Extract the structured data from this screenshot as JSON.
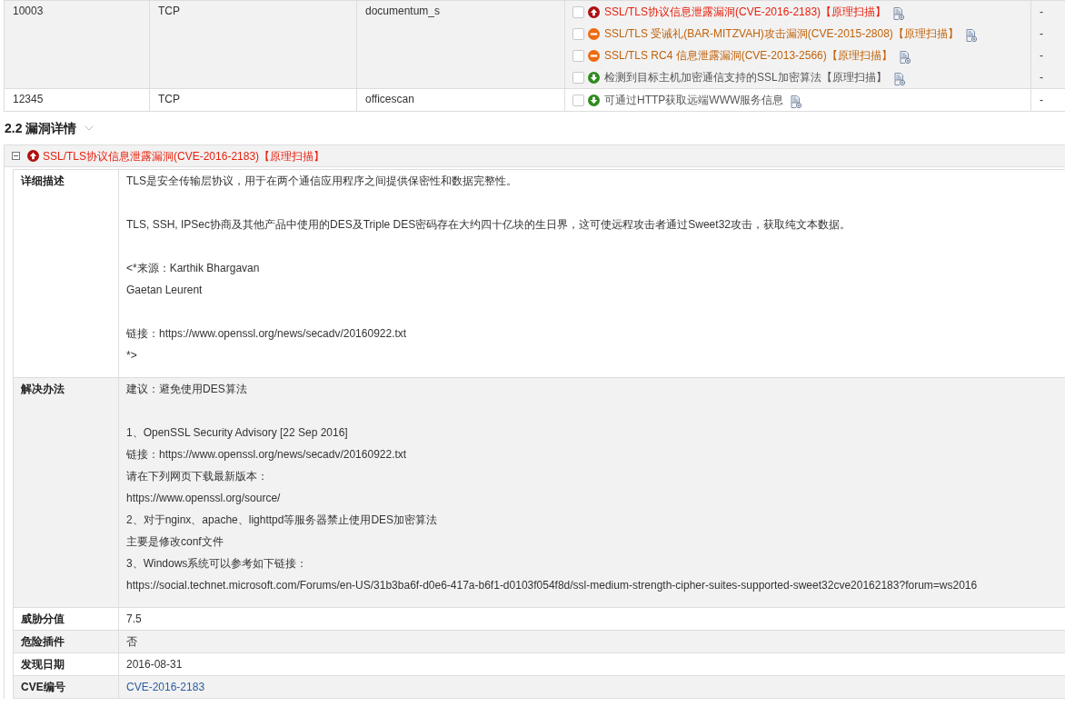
{
  "ports_table": {
    "rows": [
      {
        "port": "10003",
        "protocol": "TCP",
        "service": "documentum_s",
        "vulns": [
          {
            "kind": "high",
            "name": "SSL/TLS协议信息泄露漏洞(CVE-2016-2183)",
            "tag": "【原理扫描】",
            "checked": false,
            "extra": "-"
          },
          {
            "kind": "medium",
            "name": "SSL/TLS 受诫礼(BAR-MITZVAH)攻击漏洞(CVE-2015-2808)",
            "tag": "【原理扫描】",
            "checked": false,
            "extra": "-"
          },
          {
            "kind": "medium",
            "name": "SSL/TLS RC4 信息泄露漏洞(CVE-2013-2566)",
            "tag": "【原理扫描】",
            "checked": false,
            "extra": "-"
          },
          {
            "kind": "low",
            "name": "检测到目标主机加密通信支持的SSL加密算法",
            "tag": "【原理扫描】",
            "checked": false,
            "extra": "-"
          }
        ]
      },
      {
        "port": "12345",
        "protocol": "TCP",
        "service": "officescan",
        "vulns": [
          {
            "kind": "low",
            "name": "可通过HTTP获取远端WWW服务信息",
            "checked": false,
            "extra": "-"
          }
        ]
      }
    ]
  },
  "section": {
    "title": "2.2 漏洞详情",
    "expanded": true
  },
  "detail_panel": {
    "expanded": true,
    "kind": "high",
    "title": "SSL/TLS协议信息泄露漏洞(CVE-2016-2183)",
    "tag": "【原理扫描】",
    "fields": [
      {
        "label": "详细描述",
        "kind": "text",
        "paragraphs": [
          [
            "TLS是安全传输层协议，用于在两个通信应用程序之间提供保密性和数据完整性。"
          ],
          [
            "TLS, SSH, IPSec协商及其他产品中使用的DES及Triple DES密码存在大约四十亿块的生日界，这可使远程攻击者通过Sweet32攻击，获取纯文本数据。"
          ],
          [
            "<*来源：Karthik Bhargavan",
            "Gaetan Leurent"
          ],
          [
            "链接：https://www.openssl.org/news/secadv/20160922.txt",
            "*>"
          ]
        ]
      },
      {
        "label": "解决办法",
        "kind": "text",
        "paragraphs": [
          [
            "建议：避免使用DES算法"
          ],
          [
            "1、OpenSSL Security Advisory [22 Sep 2016]",
            "链接：https://www.openssl.org/news/secadv/20160922.txt",
            "请在下列网页下载最新版本：",
            "https://www.openssl.org/source/",
            "2、对于nginx、apache、lighttpd等服务器禁止使用DES加密算法",
            "主要是修改conf文件",
            "3、Windows系统可以参考如下链接：",
            "https://social.technet.microsoft.com/Forums/en-US/31b3ba6f-d0e6-417a-b6f1-d0103f054f8d/ssl-medium-strength-cipher-suites-supported-sweet32cve20162183?forum=ws2016"
          ]
        ]
      },
      {
        "label": "威胁分值",
        "kind": "text",
        "paragraphs": [
          [
            "7.5"
          ]
        ]
      },
      {
        "label": "危险插件",
        "kind": "text",
        "paragraphs": [
          [
            "否"
          ]
        ]
      },
      {
        "label": "发现日期",
        "kind": "text",
        "paragraphs": [
          [
            "2016-08-31"
          ]
        ]
      },
      {
        "label": "CVE编号",
        "kind": "link",
        "paragraphs": [
          [
            "CVE-2016-2183"
          ]
        ]
      }
    ]
  }
}
